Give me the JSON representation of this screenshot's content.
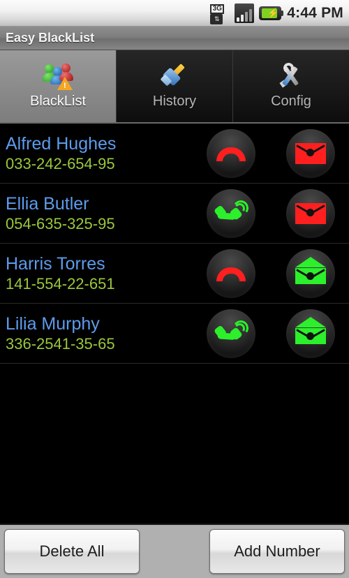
{
  "status_bar": {
    "network_label": "3G",
    "time": "4:44 PM",
    "icons": [
      "3g-data-icon",
      "signal-bars-icon",
      "battery-charging-icon"
    ]
  },
  "title_bar": {
    "app_title": "Easy BlackList"
  },
  "tabs": [
    {
      "label": "BlackList",
      "icon": "people-warning-icon",
      "active": true
    },
    {
      "label": "History",
      "icon": "brush-icon",
      "active": false
    },
    {
      "label": "Config",
      "icon": "tools-wrench-icon",
      "active": false
    }
  ],
  "list": {
    "rows": [
      {
        "name": "Alfred Hughes",
        "number": "033-242-654-95",
        "call_state": "blocked",
        "call_icon": "call-blocked-icon",
        "sms_state": "blocked",
        "sms_icon": "envelope-closed-icon"
      },
      {
        "name": "Ellia Butler",
        "number": "054-635-325-95",
        "call_state": "allowed",
        "call_icon": "call-ringing-icon",
        "sms_state": "blocked",
        "sms_icon": "envelope-closed-icon"
      },
      {
        "name": "Harris Torres",
        "number": "141-554-22-651",
        "call_state": "blocked",
        "call_icon": "call-blocked-icon",
        "sms_state": "allowed",
        "sms_icon": "envelope-open-icon"
      },
      {
        "name": "Lilia Murphy",
        "number": "336-2541-35-65",
        "call_state": "allowed",
        "call_icon": "call-ringing-icon",
        "sms_state": "allowed",
        "sms_icon": "envelope-open-icon"
      }
    ]
  },
  "bottom_bar": {
    "delete_all_label": "Delete All",
    "add_number_label": "Add Number"
  },
  "colors": {
    "name_blue": "#5d9cec",
    "number_green": "#9bc83c",
    "blocked_red": "#ff1f1f",
    "allowed_green": "#2bf02b",
    "background": "#000000",
    "title_bar_gray": "#7e7e7e"
  }
}
